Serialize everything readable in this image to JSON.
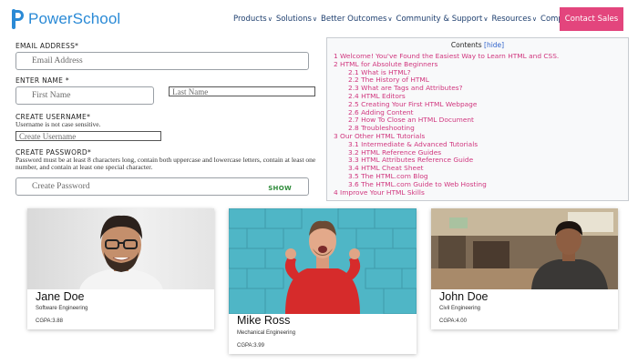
{
  "header": {
    "logo_text": "PowerSchool",
    "nav": [
      {
        "label": "Products"
      },
      {
        "label": "Solutions"
      },
      {
        "label": "Better Outcomes"
      },
      {
        "label": "Community & Support"
      },
      {
        "label": "Resources"
      },
      {
        "label": "Company"
      }
    ],
    "contact_label": "Contact Sales",
    "brand_color": "#2a8ad6",
    "accent_color": "#e3457d"
  },
  "form": {
    "email_label": "EMAIL ADDRESS*",
    "email_placeholder": "Email Address",
    "name_label": "ENTER NAME *",
    "first_placeholder": "First Name",
    "last_placeholder": "Last Name",
    "username_label": "CREATE USERNAME*",
    "username_hint": "Username is not case sensitive.",
    "username_placeholder": "Create Username",
    "password_label": "CREATE PASSWORD*",
    "password_hint": "Password must be at least 8 characters long, contain both uppercase and lowercase letters, contain at least one number, and contain at least one special character.",
    "password_placeholder": "Create Password",
    "show_label": "SHOW"
  },
  "toc": {
    "title": "Contents",
    "hide_label": "[hide]",
    "items": [
      {
        "text": "1 Welcome! You've Found the Easiest Way to Learn HTML and CSS.",
        "sub": false
      },
      {
        "text": "2 HTML for Absolute Beginners",
        "sub": false
      },
      {
        "text": "2.1 What is HTML?",
        "sub": true
      },
      {
        "text": "2.2 The History of HTML",
        "sub": true
      },
      {
        "text": "2.3 What are Tags and Attributes?",
        "sub": true
      },
      {
        "text": "2.4 HTML Editors",
        "sub": true
      },
      {
        "text": "2.5 Creating Your First HTML Webpage",
        "sub": true
      },
      {
        "text": "2.6 Adding Content",
        "sub": true
      },
      {
        "text": "2.7 How To Close an HTML Document",
        "sub": true
      },
      {
        "text": "2.8 Troubleshooting",
        "sub": true
      },
      {
        "text": "3 Our Other HTML Tutorials",
        "sub": false
      },
      {
        "text": "3.1 Intermediate & Advanced Tutorials",
        "sub": true
      },
      {
        "text": "3.2 HTML Reference Guides",
        "sub": true
      },
      {
        "text": "3.3 HTML Attributes Reference Guide",
        "sub": true
      },
      {
        "text": "3.4 HTML Cheat Sheet",
        "sub": true
      },
      {
        "text": "3.5 The HTML.com Blog",
        "sub": true
      },
      {
        "text": "3.6 The HTML.com Guide to Web Hosting",
        "sub": true
      },
      {
        "text": "4 Improve Your HTML Skills",
        "sub": false
      }
    ]
  },
  "cards": [
    {
      "name": "Jane Doe",
      "dept": "Software Engineering",
      "gpa": "CGPA:3.88"
    },
    {
      "name": "Mike Ross",
      "dept": "Mechanical Engineering",
      "gpa": "CGPA:3.99"
    },
    {
      "name": "John Doe",
      "dept": "Civil Engineering",
      "gpa": "CGPA:4.00"
    }
  ]
}
